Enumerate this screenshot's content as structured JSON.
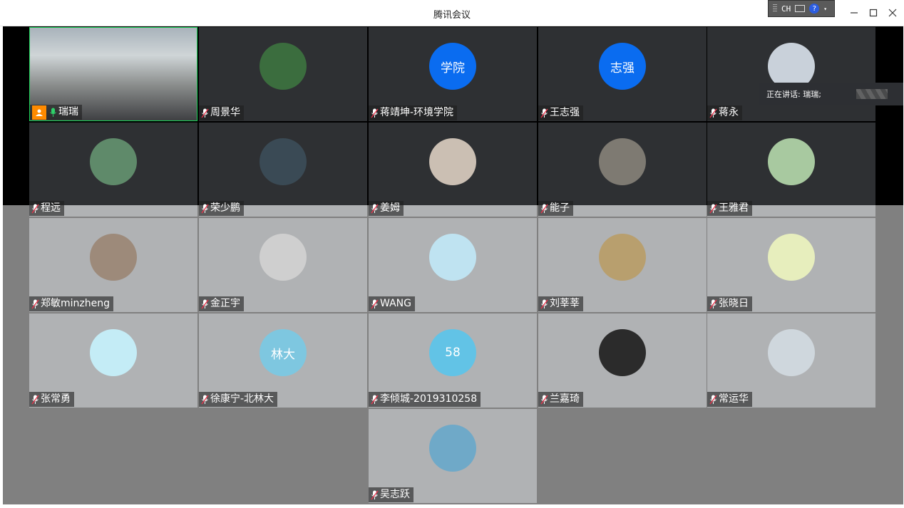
{
  "window": {
    "title": "腾讯会议"
  },
  "ime": {
    "label": "CH"
  },
  "speaking": {
    "label": "正在讲话: 瑞瑞;"
  },
  "participants": [
    {
      "name": "瑞瑞",
      "kind": "video"
    },
    {
      "name": "周景华",
      "kind": "photo",
      "bg": "#3b6d3e"
    },
    {
      "name": "蒋靖坤-环境学院",
      "kind": "text",
      "avatar_text": "学院",
      "bg": "#0a6cf0"
    },
    {
      "name": "王志强",
      "kind": "text",
      "avatar_text": "志强",
      "bg": "#0a6cf0"
    },
    {
      "name": "蒋永",
      "kind": "photo",
      "bg": "#c9d1da"
    },
    {
      "name": "程远",
      "kind": "photo",
      "bg": "#5f8a6a"
    },
    {
      "name": "荣少鹏",
      "kind": "photo",
      "bg": "#3a4a55"
    },
    {
      "name": "姜姆",
      "kind": "photo",
      "bg": "#cbbfb3"
    },
    {
      "name": "能子",
      "kind": "photo",
      "bg": "#7e7a72"
    },
    {
      "name": "王雅君",
      "kind": "photo",
      "bg": "#a8c9a0"
    },
    {
      "name": "郑敏minzheng",
      "kind": "photo",
      "bg": "#9d8a7a"
    },
    {
      "name": "金正宇",
      "kind": "photo",
      "bg": "#cfcfcf"
    },
    {
      "name": "WANG",
      "kind": "photo",
      "bg": "#bfe3f1"
    },
    {
      "name": "刘莘莘",
      "kind": "photo",
      "bg": "#b89f6e"
    },
    {
      "name": "张晓日",
      "kind": "photo",
      "bg": "#e7eebd"
    },
    {
      "name": "张常勇",
      "kind": "photo",
      "bg": "#c4ecf6"
    },
    {
      "name": "徐康宁-北林大",
      "kind": "text",
      "avatar_text": "林大",
      "bg": "#7ec7e0"
    },
    {
      "name": "李倾城-2019310258",
      "kind": "text",
      "avatar_text": "58",
      "bg": "#62c3e6"
    },
    {
      "name": "兰嘉琦",
      "kind": "photo",
      "bg": "#2b2b2b"
    },
    {
      "name": "常运华",
      "kind": "photo",
      "bg": "#cfd7dd"
    },
    {
      "name": "吴志跃",
      "kind": "photo",
      "bg": "#6fa9c8"
    }
  ]
}
